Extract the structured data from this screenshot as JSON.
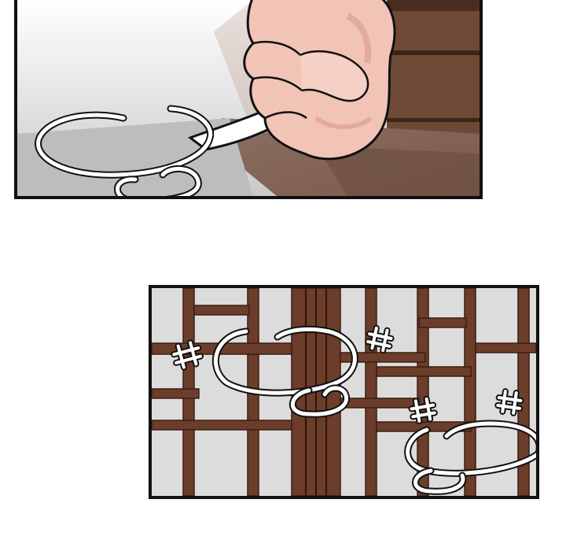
{
  "comic": {
    "panels": [
      {
        "id": "top",
        "scene": "hand-gripping-white-cloth",
        "sfx": "swoosh-loop-effect"
      },
      {
        "id": "bottom",
        "scene": "wooden-lattice-door",
        "sfx": "scribble-loops-and-hash-marks"
      }
    ]
  },
  "colors": {
    "border": "#111111",
    "skin": "#f1c4b6",
    "skin_shadow": "#d99b8e",
    "wood": "#6b3d2a",
    "wood_dark": "#4a2719",
    "glass": "#dcdcdc",
    "wall_brown": "#6e4a36"
  }
}
